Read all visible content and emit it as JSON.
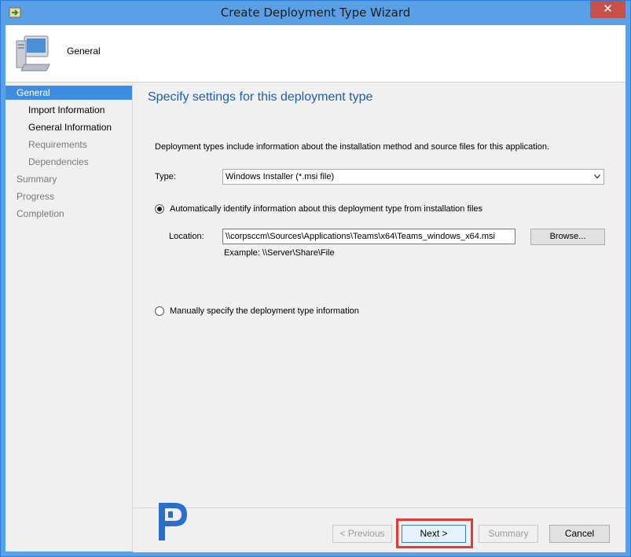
{
  "window": {
    "title": "Create Deployment Type Wizard",
    "close_glyph": "✕"
  },
  "header": {
    "title": "General"
  },
  "sidebar": {
    "items": [
      {
        "label": "General",
        "state": "active"
      },
      {
        "label": "Import Information",
        "state": "done"
      },
      {
        "label": "General Information",
        "state": "done"
      },
      {
        "label": "Requirements",
        "state": "pending"
      },
      {
        "label": "Dependencies",
        "state": "pending"
      },
      {
        "label": "Summary",
        "state": "pending"
      },
      {
        "label": "Progress",
        "state": "pending"
      },
      {
        "label": "Completion",
        "state": "pending"
      }
    ]
  },
  "main": {
    "heading": "Specify settings for this deployment type",
    "description": "Deployment types include information about the installation method and source files for this application.",
    "type_label": "Type:",
    "type_value": "Windows Installer (*.msi file)",
    "auto_option": {
      "label": "Automatically identify information about this deployment type from installation files",
      "selected": true
    },
    "location_label": "Location:",
    "location_value": "\\\\corpsccm\\Sources\\Applications\\Teams\\x64\\Teams_windows_x64.msi",
    "browse_label": "Browse...",
    "example_text": "Example:  \\\\Server\\Share\\File",
    "manual_option": {
      "label": "Manually specify the deployment type information",
      "selected": false
    }
  },
  "footer": {
    "previous_label": "< Previous",
    "next_label": "Next >",
    "summary_label": "Summary",
    "cancel_label": "Cancel"
  },
  "colors": {
    "accent": "#3d8ee3",
    "heading": "#1e5fa8",
    "highlight": "#e03a3a",
    "titlebar": "#5aa0e6"
  },
  "icons": [
    "app-wizard-icon",
    "computer-icon",
    "chevron-down-icon",
    "watermark-logo"
  ]
}
